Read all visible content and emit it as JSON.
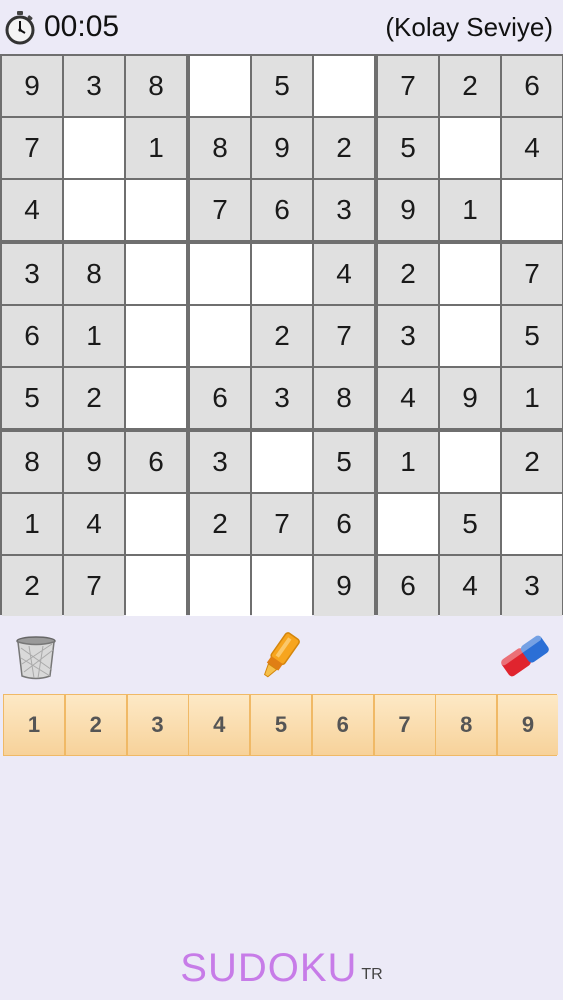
{
  "header": {
    "timer": "00:05",
    "level": "(Kolay Seviye)"
  },
  "board": {
    "rows": [
      [
        "9",
        "3",
        "8",
        "",
        "5",
        "",
        "7",
        "2",
        "6"
      ],
      [
        "7",
        "",
        "1",
        "8",
        "9",
        "2",
        "5",
        "",
        "4"
      ],
      [
        "4",
        "",
        "",
        "7",
        "6",
        "3",
        "9",
        "1",
        ""
      ],
      [
        "3",
        "8",
        "",
        "",
        "",
        "4",
        "2",
        "",
        "7"
      ],
      [
        "6",
        "1",
        "",
        "",
        "2",
        "7",
        "3",
        "",
        "5"
      ],
      [
        "5",
        "2",
        "",
        "6",
        "3",
        "8",
        "4",
        "9",
        "1"
      ],
      [
        "8",
        "9",
        "6",
        "3",
        "",
        "5",
        "1",
        "",
        "2"
      ],
      [
        "1",
        "4",
        "",
        "2",
        "7",
        "6",
        "",
        "5",
        ""
      ],
      [
        "2",
        "7",
        "",
        "",
        "",
        "9",
        "6",
        "4",
        "3"
      ]
    ]
  },
  "tools": {
    "trash_icon": "trash-icon",
    "marker_icon": "marker-icon",
    "eraser_icon": "eraser-icon"
  },
  "numpad": {
    "keys": [
      "1",
      "2",
      "3",
      "4",
      "5",
      "6",
      "7",
      "8",
      "9"
    ]
  },
  "branding": {
    "logo": "SUDOKU",
    "suffix": "TR"
  },
  "colors": {
    "background": "#eceaf7",
    "given_cell": "#e0e0e0",
    "empty_cell": "#ffffff",
    "grid_line": "#6f6f6f",
    "numpad_key": "#f7d29a",
    "logo": "#c77ce8"
  }
}
